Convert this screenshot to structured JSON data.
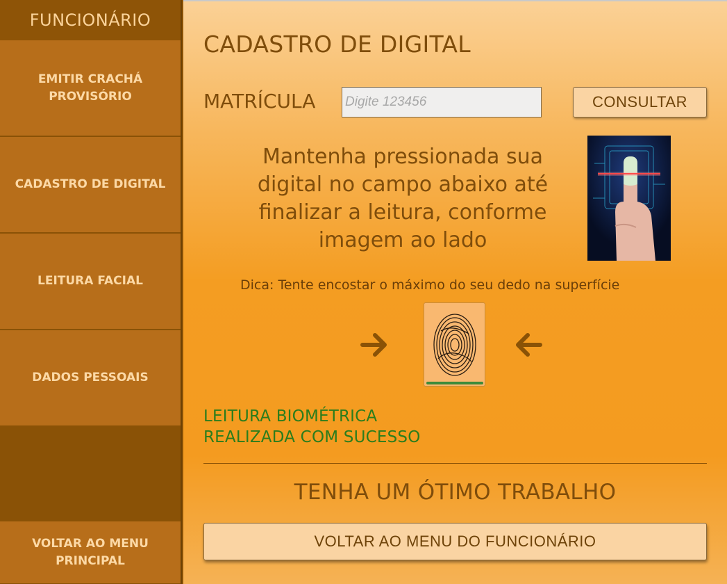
{
  "sidebar": {
    "title": "FUNCIONÁRIO",
    "items": [
      {
        "label": "EMITIR CRACHÁ PROVISÓRIO"
      },
      {
        "label": "CADASTRO DE DIGITAL"
      },
      {
        "label": "LEITURA FACIAL"
      },
      {
        "label": "DADOS PESSOAIS"
      }
    ],
    "back_label": "VOLTAR AO MENU PRINCIPAL"
  },
  "main": {
    "title": "CADASTRO DE DIGITAL",
    "matricula": {
      "label": "MATRÍCULA",
      "placeholder": "Digite 123456",
      "value": ""
    },
    "consult_button": "CONSULTAR",
    "instruction": "Mantenha pressionada sua digital no campo abaixo até finalizar a leitura, conforme imagem ao lado",
    "tip": "Dica: Tente encostar o máximo do seu dedo na superfície",
    "success_line1": "LEITURA BIOMÉTRICA",
    "success_line2": "REALIZADA COM SUCESSO",
    "goodbye": "TENHA UM ÓTIMO TRABALHO",
    "back_button": "VOLTAR AO MENU DO FUNCIONÁRIO"
  },
  "icons": {
    "photo": "finger-scan-photo-icon",
    "arrow_right": "arrow-right-icon",
    "arrow_left": "arrow-left-icon",
    "sensor": "fingerprint-icon"
  },
  "colors": {
    "accent": "#f49d22",
    "sidebar": "#b76e1a",
    "sidebar_dark": "#8a5206",
    "success": "#2b7d1c",
    "text_brown": "#7f4d0b",
    "button": "#fad4a3"
  },
  "scan_progress": 1.0
}
